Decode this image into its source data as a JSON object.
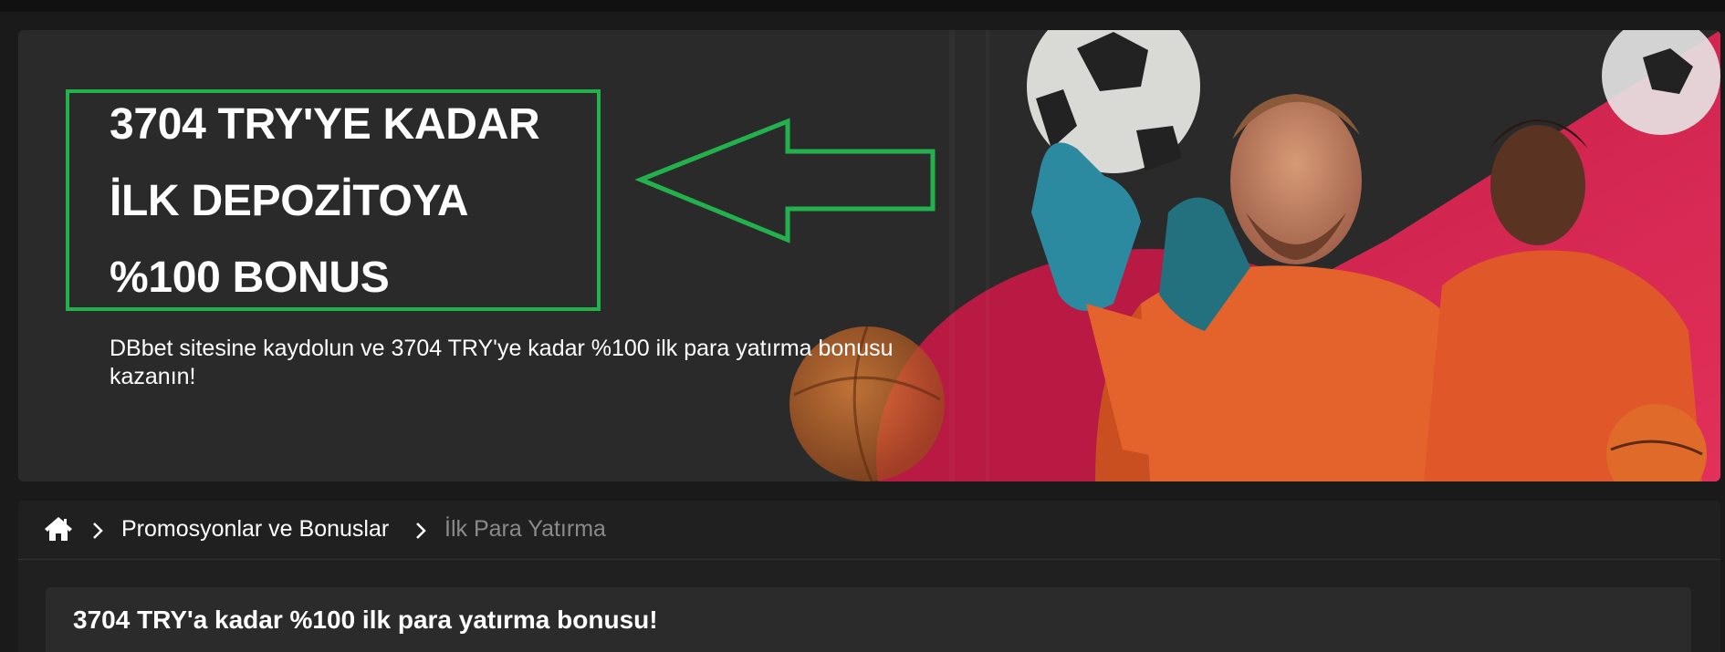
{
  "hero": {
    "title_lines": [
      "3704 TRY'YE KADAR",
      "İLK DEPOZİTOYA",
      "%100 BONUS"
    ],
    "subtitle": "DBbet sitesine kaydolun ve 3704 TRY'ye kadar %100 ilk para yatırma bonusu kazanın!",
    "highlight_color": "#22b14c"
  },
  "breadcrumb": {
    "home_icon": "home-icon",
    "separator_icon": "chevron-right-icon",
    "items": [
      "Promosyonlar ve Bonuslar",
      "İlk Para Yatırma"
    ]
  },
  "promo": {
    "title": "3704 TRY'a kadar %100 ilk para yatırma bonusu!"
  }
}
